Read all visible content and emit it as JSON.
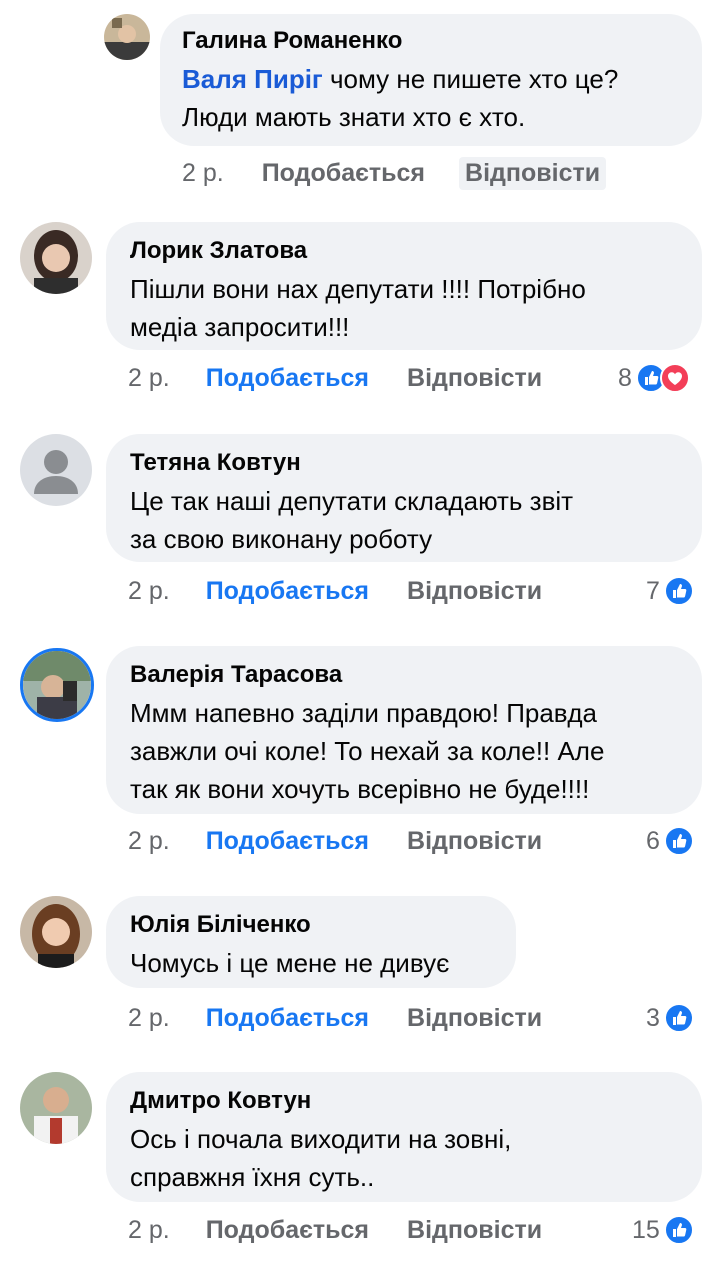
{
  "colors": {
    "bubble": "#f0f2f5",
    "like_active": "#1877f2",
    "meta": "#65676b",
    "mention": "#1a5bd6"
  },
  "comments": [
    {
      "author": "Галина Романенко",
      "mention": "Валя Пиріг",
      "text_after_mention": " чому не пишете хто це?\nЛюди мають знати хто є хто.",
      "time": "2 р.",
      "like_label": "Подобається",
      "reply_label": "Відповісти",
      "reactions": ""
    },
    {
      "author": "Лорик Златова",
      "text": "Пішли вони нах депутати  !!!! Потрібно\nмедіа запросити!!!",
      "time": "2 р.",
      "like_label": "Подобається",
      "reply_label": "Відповісти",
      "reactions": "8",
      "reaction_icons": [
        "like-icon",
        "love-icon"
      ]
    },
    {
      "author": "Тетяна Ковтун",
      "text": "Це так наші депутати складають звіт\nза свою виконану роботу",
      "time": "2 р.",
      "like_label": "Подобається",
      "reply_label": "Відповісти",
      "reactions": "7",
      "reaction_icons": [
        "like-icon"
      ]
    },
    {
      "author": "Валерія Тарасова",
      "text": "Ммм напевно заділи правдою! Правда\nзавжли очі коле! То нехай за коле!! Але\nтак як вони хочуть всерівно не буде!!!!",
      "time": "2 р.",
      "like_label": "Подобається",
      "reply_label": "Відповісти",
      "reactions": "6",
      "reaction_icons": [
        "like-icon"
      ]
    },
    {
      "author": "Юлія Біліченко",
      "text": "Чомусь і це мене не дивує",
      "time": "2 р.",
      "like_label": "Подобається",
      "reply_label": "Відповісти",
      "reactions": "3",
      "reaction_icons": [
        "like-icon"
      ]
    },
    {
      "author": "Дмитро Ковтун",
      "text": "Ось і почала виходити на зовні,\nсправжня їхня суть..",
      "time": "2 р.",
      "like_label": "Подобається",
      "reply_label": "Відповісти",
      "reactions": "15",
      "reaction_icons": [
        "like-icon"
      ]
    }
  ]
}
